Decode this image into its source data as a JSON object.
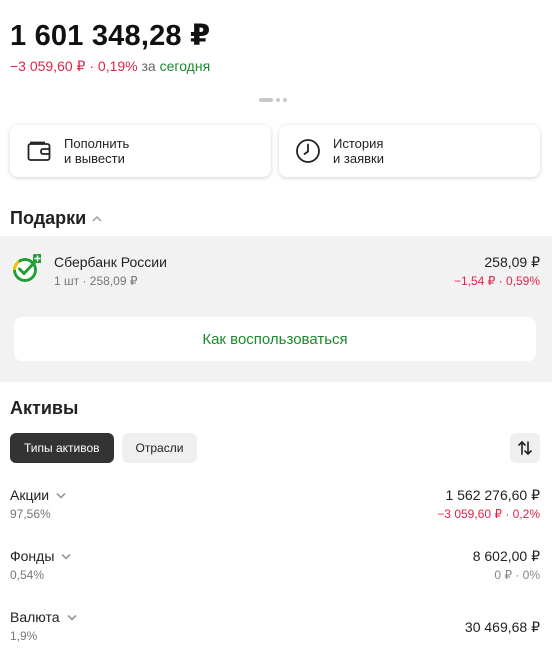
{
  "portfolio": {
    "balance": "1 601 348,28 ₽",
    "change": "−3 059,60 ₽ · 0,19%",
    "change_word": "за",
    "change_period": "сегодня"
  },
  "actions": {
    "topup_label": "Пополнить\nи вывести",
    "history_label": "История\nи заявки"
  },
  "gifts": {
    "title": "Подарки",
    "item": {
      "name": "Сбербанк России",
      "sub": "1 шт · 258,09 ₽",
      "value": "258,09 ₽",
      "change": "−1,54 ₽ · 0,59%"
    },
    "howto_label": "Как воспользоваться"
  },
  "assets": {
    "title": "Активы",
    "tabs": [
      "Типы активов",
      "Отрасли"
    ],
    "rows": [
      {
        "name": "Акции",
        "pct": "97,56%",
        "value": "1 562 276,60 ₽",
        "change": "−3 059,60 ₽ · 0,2%"
      },
      {
        "name": "Фонды",
        "pct": "0,54%",
        "value": "8 602,00 ₽",
        "change": "0 ₽ · 0%"
      },
      {
        "name": "Валюта",
        "pct": "1,9%",
        "value": "30 469,68 ₽",
        "change": ""
      }
    ]
  },
  "colors": {
    "negative": "#e0254a",
    "positive": "#1b8a2b",
    "tab_active_bg": "#333333",
    "panel_bg": "#f2f2f2"
  }
}
